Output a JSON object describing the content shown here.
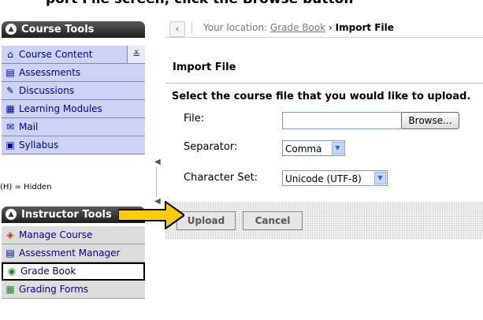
{
  "header_fragment": "port File screen, click the Browse button",
  "sidebar": {
    "course_tools": {
      "title": "Course Tools",
      "items": [
        {
          "label": "Course Content",
          "icon": "home-icon"
        },
        {
          "label": "Assessments",
          "icon": "clipboard-icon"
        },
        {
          "label": "Discussions",
          "icon": "pushpin-icon"
        },
        {
          "label": "Learning Modules",
          "icon": "book-icon"
        },
        {
          "label": "Mail",
          "icon": "mail-icon"
        },
        {
          "label": "Syllabus",
          "icon": "syllabus-icon"
        }
      ],
      "hidden_note": "(H) = Hidden"
    },
    "instructor_tools": {
      "title": "Instructor Tools",
      "items": [
        {
          "label": "Manage Course",
          "icon": "box-icon"
        },
        {
          "label": "Assessment Manager",
          "icon": "clipboard-icon"
        },
        {
          "label": "Grade Book",
          "icon": "grade-book-icon",
          "active": true
        },
        {
          "label": "Grading Forms",
          "icon": "grid-icon"
        }
      ]
    }
  },
  "breadcrumb": {
    "prefix": "Your location:",
    "link": "Grade Book",
    "separator": "›",
    "current": "Import File"
  },
  "page": {
    "title": "Import File",
    "instructions": "Select the course file that you would like to upload."
  },
  "form": {
    "file_label": "File:",
    "file_value": "",
    "browse_label": "Browse...",
    "separator_label": "Separator:",
    "separator_value": "Comma",
    "charset_label": "Character Set:",
    "charset_value": "Unicode (UTF-8)"
  },
  "actions": {
    "upload_label": "Upload",
    "cancel_label": "Cancel"
  },
  "colors": {
    "course_tools_bg": "#cdd3f3",
    "instructor_tools_bg": "#dddddd",
    "link_color": "#000099",
    "header_dark": "#1e1e1e",
    "callout_arrow": "#ffcc00"
  }
}
